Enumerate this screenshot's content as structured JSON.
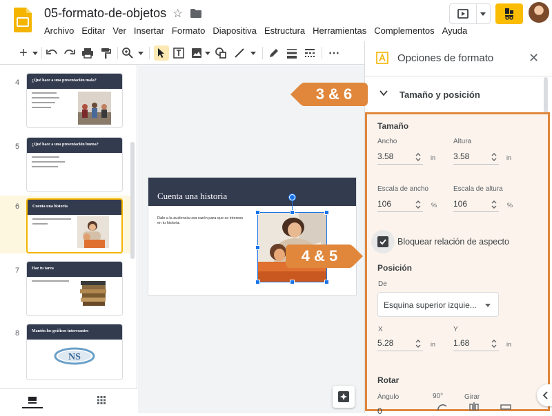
{
  "app": {
    "doc_title": "05-formato-de-objetos",
    "menu": [
      "Archivo",
      "Editar",
      "Ver",
      "Insertar",
      "Formato",
      "Diapositiva",
      "Estructura",
      "Herramientas",
      "Complementos",
      "Ayuda"
    ]
  },
  "filmstrip": {
    "slides": [
      {
        "num": "4",
        "title": "¿Qué hace a una presentación mala?"
      },
      {
        "num": "5",
        "title": "¿Qué hace a una presentación buena?"
      },
      {
        "num": "6",
        "title": "Cuenta una historia"
      },
      {
        "num": "7",
        "title": "Haz tu tarea"
      },
      {
        "num": "8",
        "title": "Mantén los gráficos interesantes"
      }
    ],
    "selected_num": "6"
  },
  "slide": {
    "title": "Cuenta una historia",
    "body": "Dale a la audiencia una razón para que se interese en tu historia."
  },
  "callouts": {
    "top": "3 & 6",
    "middle": "4 & 5"
  },
  "panel": {
    "title": "Opciones de formato",
    "section": "Tamaño y posición",
    "size": {
      "heading": "Tamaño",
      "width_label": "Ancho",
      "width_value": "3.58",
      "width_unit": "in",
      "height_label": "Altura",
      "height_value": "3.58",
      "height_unit": "in",
      "scale_w_label": "Escala de ancho",
      "scale_w_value": "106",
      "scale_w_unit": "%",
      "scale_h_label": "Escala de altura",
      "scale_h_value": "106",
      "scale_h_unit": "%"
    },
    "lock_label": "Bloquear relación de aspecto",
    "lock_checked": true,
    "position": {
      "heading": "Posición",
      "from_label": "De",
      "from_value": "Esquina superior izquie...",
      "x_label": "X",
      "x_value": "5.28",
      "x_unit": "in",
      "y_label": "Y",
      "y_value": "1.68",
      "y_unit": "in"
    },
    "rotate": {
      "heading": "Rotar",
      "angle_label": "Ángulo",
      "angle_value": "0",
      "rotate90_label": "90°",
      "flip_label": "Girar"
    }
  },
  "colors": {
    "accent_orange": "#e0873c",
    "slide_header": "#333b4f",
    "selection_blue": "#1a73e8",
    "slides_yellow": "#f4b400"
  }
}
